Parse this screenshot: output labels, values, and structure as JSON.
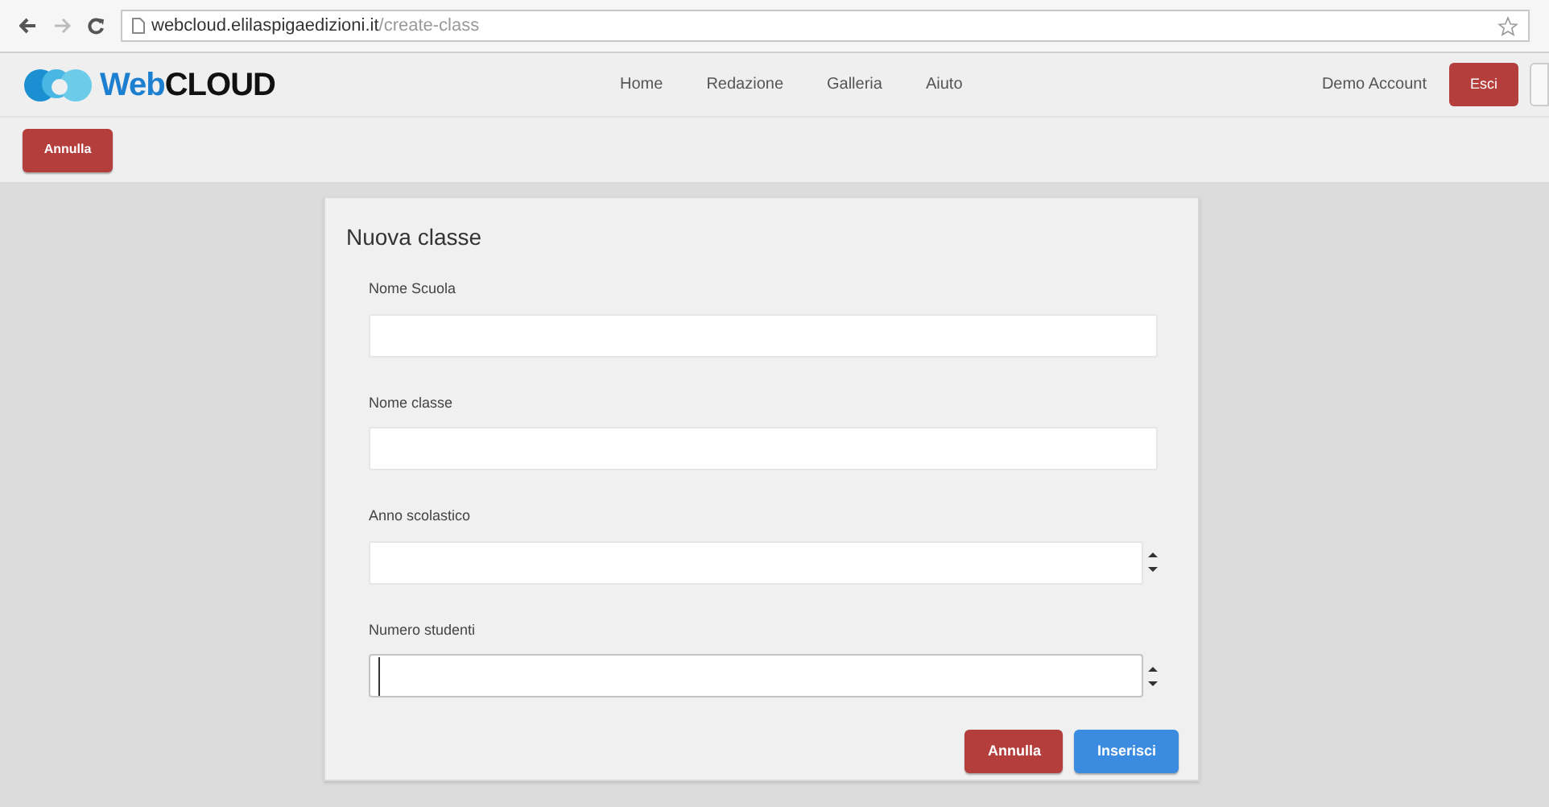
{
  "browser": {
    "url_host": "webcloud.elilaspigaedizioni.it",
    "url_path": "/create-class"
  },
  "navbar": {
    "logo": {
      "prefix": "Web",
      "suffix": "CLOUD"
    },
    "links": [
      "Home",
      "Redazione",
      "Galleria",
      "Aiuto"
    ],
    "account": "Demo Account",
    "logout": "Esci"
  },
  "toolbar": {
    "cancel": "Annulla"
  },
  "form": {
    "title": "Nuova classe",
    "fields": [
      {
        "label": "Nome Scuola",
        "kind": "text",
        "focused": false
      },
      {
        "label": "Nome classe",
        "kind": "text",
        "focused": false
      },
      {
        "label": "Anno scolastico",
        "kind": "number",
        "focused": false
      },
      {
        "label": "Numero studenti",
        "kind": "number",
        "focused": true
      }
    ],
    "buttons": [
      {
        "label": "Annulla",
        "kind": "cancel"
      },
      {
        "label": "Inserisci",
        "kind": "submit"
      }
    ]
  }
}
